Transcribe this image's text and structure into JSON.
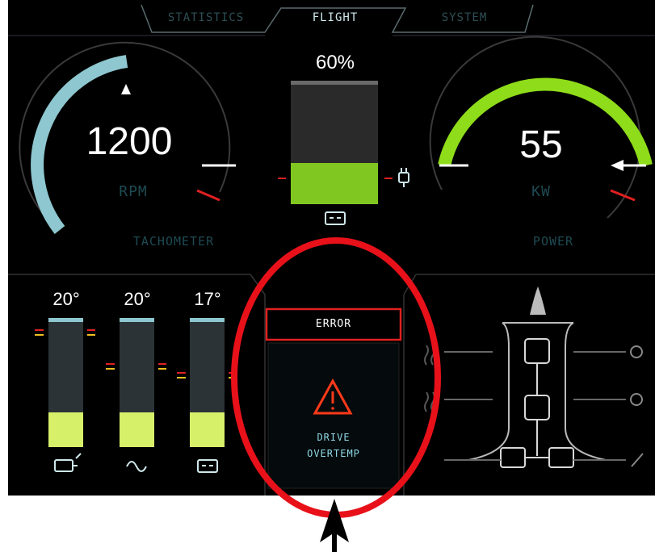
{
  "tabs": [
    {
      "label": "STATISTICS",
      "active": false
    },
    {
      "label": "FLIGHT",
      "active": true
    },
    {
      "label": "SYSTEM",
      "active": false
    }
  ],
  "tachometer": {
    "value": "1200",
    "unit": "RPM",
    "caption": "TACHOMETER",
    "level": 0.35
  },
  "battery": {
    "percent_label": "60%",
    "level": 0.6,
    "fill_color": "#80c821"
  },
  "power": {
    "value": "55",
    "unit": "KW",
    "caption": "POWER",
    "level": 0.75
  },
  "temperatures": [
    {
      "label": "20°",
      "level": 0.28,
      "icon": "motor-icon"
    },
    {
      "label": "20°",
      "level": 0.28,
      "icon": "controller-icon"
    },
    {
      "label": "17°",
      "level": 0.28,
      "icon": "battery-icon"
    }
  ],
  "error": {
    "label": "ERROR",
    "message_line1": "DRIVE",
    "message_line2": "OVERTEMP"
  },
  "colors": {
    "teal": "#8ec7cf",
    "green": "#8edc1a",
    "alert_red": "#e02020",
    "temp_fill": "#d7f06a"
  }
}
